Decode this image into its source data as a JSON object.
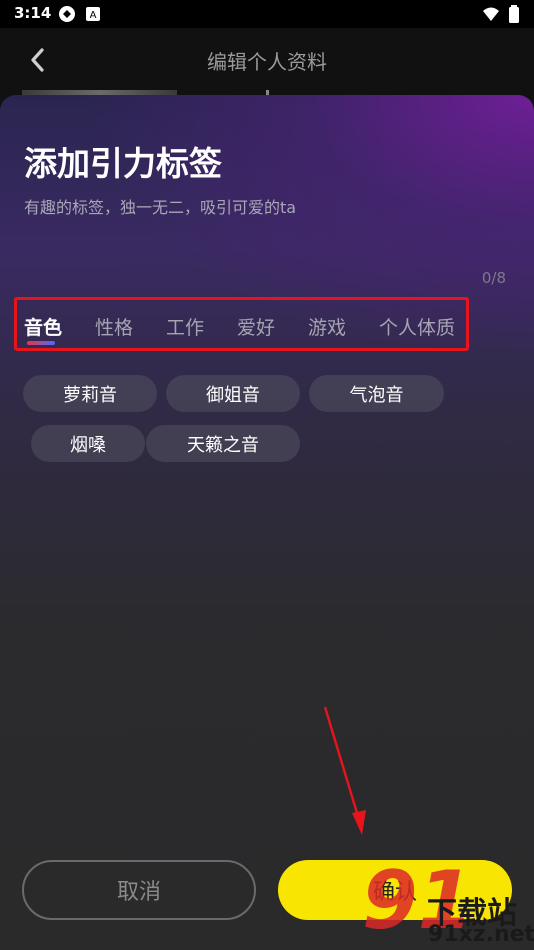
{
  "status_bar": {
    "time": "3:14",
    "icons": [
      "app-icon",
      "font-icon",
      "wifi-icon",
      "battery-icon"
    ]
  },
  "nav": {
    "title": "编辑个人资料",
    "back_icon": "chevron-left-icon"
  },
  "sheet": {
    "title": "添加引力标签",
    "subtitle": "有趣的标签，独一无二，吸引可爱的ta",
    "counter": "0/8",
    "tabs": [
      {
        "label": "音色",
        "active": true
      },
      {
        "label": "性格",
        "active": false
      },
      {
        "label": "工作",
        "active": false
      },
      {
        "label": "爱好",
        "active": false
      },
      {
        "label": "游戏",
        "active": false
      },
      {
        "label": "个人体质",
        "active": false
      }
    ],
    "tags": [
      "萝莉音",
      "御姐音",
      "气泡音",
      "烟嗓",
      "天籁之音"
    ]
  },
  "buttons": {
    "cancel_label": "取消",
    "confirm_label": "确认"
  },
  "annotation": {
    "highlight_color": "#e8141c",
    "arrow_color": "#e8141c"
  },
  "watermark": {
    "logo_number": "91",
    "text_top": "下载站",
    "text_bottom": "91xz.net"
  },
  "colors": {
    "confirm_bg": "#f8e501",
    "tab_active": "#ffffff",
    "tab_inactive": "#a6a3b3"
  }
}
